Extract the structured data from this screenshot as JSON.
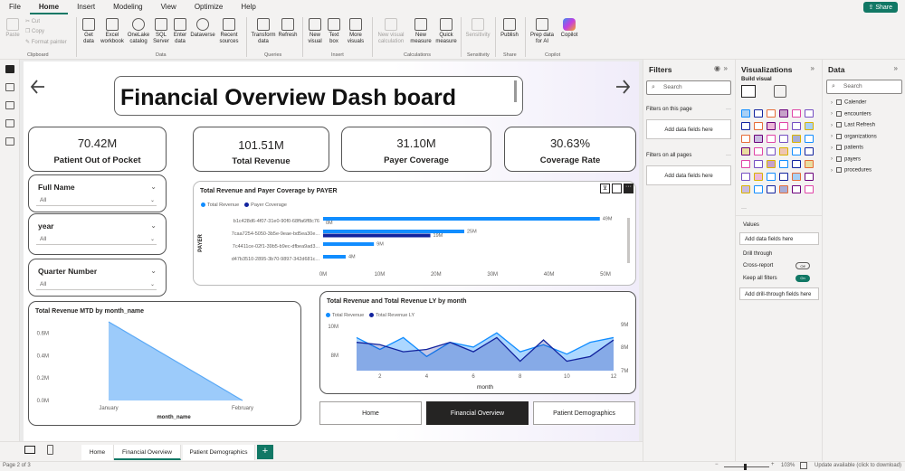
{
  "menu": {
    "items": [
      "File",
      "Home",
      "Insert",
      "Modeling",
      "View",
      "Optimize",
      "Help"
    ],
    "share_label": "Share"
  },
  "ribbon": {
    "clipboard": {
      "paste": "Paste",
      "cut": "Cut",
      "copy": "Copy",
      "format_painter": "Format painter",
      "group": "Clipboard"
    },
    "data": {
      "get_data": "Get data",
      "excel": "Excel workbook",
      "onelake": "OneLake catalog",
      "sql": "SQL Server",
      "enter": "Enter data",
      "dataverse": "Dataverse",
      "recent": "Recent sources",
      "group": "Data"
    },
    "queries": {
      "transform": "Transform data",
      "refresh": "Refresh",
      "group": "Queries"
    },
    "insert": {
      "new_visual": "New visual",
      "text_box": "Text box",
      "more_visuals": "More visuals",
      "group": "Insert"
    },
    "calculations": {
      "new_visual_calc": "New visual calculation",
      "new_measure": "New measure",
      "quick_measure": "Quick measure",
      "group": "Calculations"
    },
    "sensitivity": {
      "label": "Sensitivity",
      "group": "Sensitivity"
    },
    "share": {
      "publish": "Publish",
      "group": "Share"
    },
    "copilot": {
      "prep": "Prep data for AI",
      "copilot": "Copilot",
      "group": "Copilot"
    }
  },
  "report": {
    "title": "Financial Overview Dash board",
    "kpis": [
      {
        "value": "70.42M",
        "label": "Patient Out of Pocket"
      },
      {
        "value": "101.51M",
        "label": "Total Revenue"
      },
      {
        "value": "31.10M",
        "label": "Payer Coverage"
      },
      {
        "value": "30.63%",
        "label": "Coverage Rate"
      }
    ],
    "slicers": [
      {
        "title": "Full Name",
        "value": "All"
      },
      {
        "title": "year",
        "value": "All"
      },
      {
        "title": "Quarter Number",
        "value": "All"
      }
    ],
    "nav_buttons": [
      "Home",
      "Financial Overview",
      "Patient Demographics"
    ]
  },
  "chart_data": [
    {
      "type": "bar",
      "title": "Total Revenue and Payer Coverage by PAYER",
      "ylabel": "PAYER",
      "xlim": [
        0,
        50
      ],
      "x_ticks": [
        "0M",
        "10M",
        "20M",
        "30M",
        "40M",
        "50M"
      ],
      "categories": [
        "b1c428d6-4f07-31e0-90f0-68ffa6ff8c76",
        "7caa7254-5050-3b5e-9eae-bd5ea30e...",
        "7c4411ce-02f1-39b5-b9ec-dfbea9ad3...",
        "d47b3510-2895-3b70-9897-342d681c..."
      ],
      "series": [
        {
          "name": "Total Revenue",
          "values": [
            49,
            25,
            9,
            4
          ],
          "labels": [
            "49M",
            "25M",
            "9M",
            "4M"
          ],
          "color": "#118dff"
        },
        {
          "name": "Payer Coverage",
          "values": [
            0,
            19,
            0,
            0
          ],
          "labels": [
            "0M",
            "19M",
            "",
            ""
          ],
          "color": "#12239e"
        }
      ]
    },
    {
      "type": "area",
      "title": "Total Revenue MTD by month_name",
      "xlabel": "month_name",
      "categories": [
        "January",
        "February"
      ],
      "values": [
        0.7,
        0.0
      ],
      "ylim": [
        0,
        0.7
      ],
      "y_ticks": [
        "0.0M",
        "0.2M",
        "0.4M",
        "0.6M"
      ],
      "color": "#5aa9f6"
    },
    {
      "type": "area",
      "title": "Total Revenue and Total Revenue LY by month",
      "xlabel": "month",
      "x": [
        1,
        2,
        3,
        4,
        5,
        6,
        7,
        8,
        9,
        10,
        11,
        12
      ],
      "x_ticks": [
        "2",
        "4",
        "6",
        "8",
        "10",
        "12"
      ],
      "left_ticks": [
        "8M",
        "10M"
      ],
      "right_ticks": [
        "7M",
        "8M",
        "9M"
      ],
      "series": [
        {
          "name": "Total Revenue",
          "values": [
            8.9,
            8.4,
            8.9,
            8.1,
            8.7,
            8.5,
            9.1,
            8.3,
            8.6,
            8.2,
            8.7,
            8.9
          ],
          "color": "#118dff"
        },
        {
          "name": "Total Revenue LY",
          "values": [
            8.7,
            8.6,
            8.3,
            8.4,
            8.7,
            8.3,
            8.9,
            7.9,
            8.8,
            7.9,
            8.1,
            8.8
          ],
          "color": "#12239e"
        }
      ]
    }
  ],
  "filters": {
    "title": "Filters",
    "search": "Search",
    "on_page": "Filters on this page",
    "all_pages": "Filters on all pages",
    "add": "Add data fields here"
  },
  "visualizations": {
    "title": "Visualizations",
    "build": "Build visual",
    "values": "Values",
    "add": "Add data fields here",
    "drill": "Drill through",
    "cross": "Cross-report",
    "cross_state": "Off",
    "keep": "Keep all filters",
    "keep_state": "On",
    "add_drill": "Add drill-through fields here"
  },
  "data_pane": {
    "title": "Data",
    "search": "Search",
    "tables": [
      "Calender",
      "encounters",
      "Last Refresh",
      "organizations",
      "patients",
      "payers",
      "procedures"
    ]
  },
  "page_tabs": {
    "tabs": [
      "Home",
      "Financial Overview",
      "Patient Demographics"
    ],
    "add": "+"
  },
  "status": {
    "page": "Page 2 of 3",
    "zoom": "103%",
    "update": "Update available (click to download)"
  }
}
